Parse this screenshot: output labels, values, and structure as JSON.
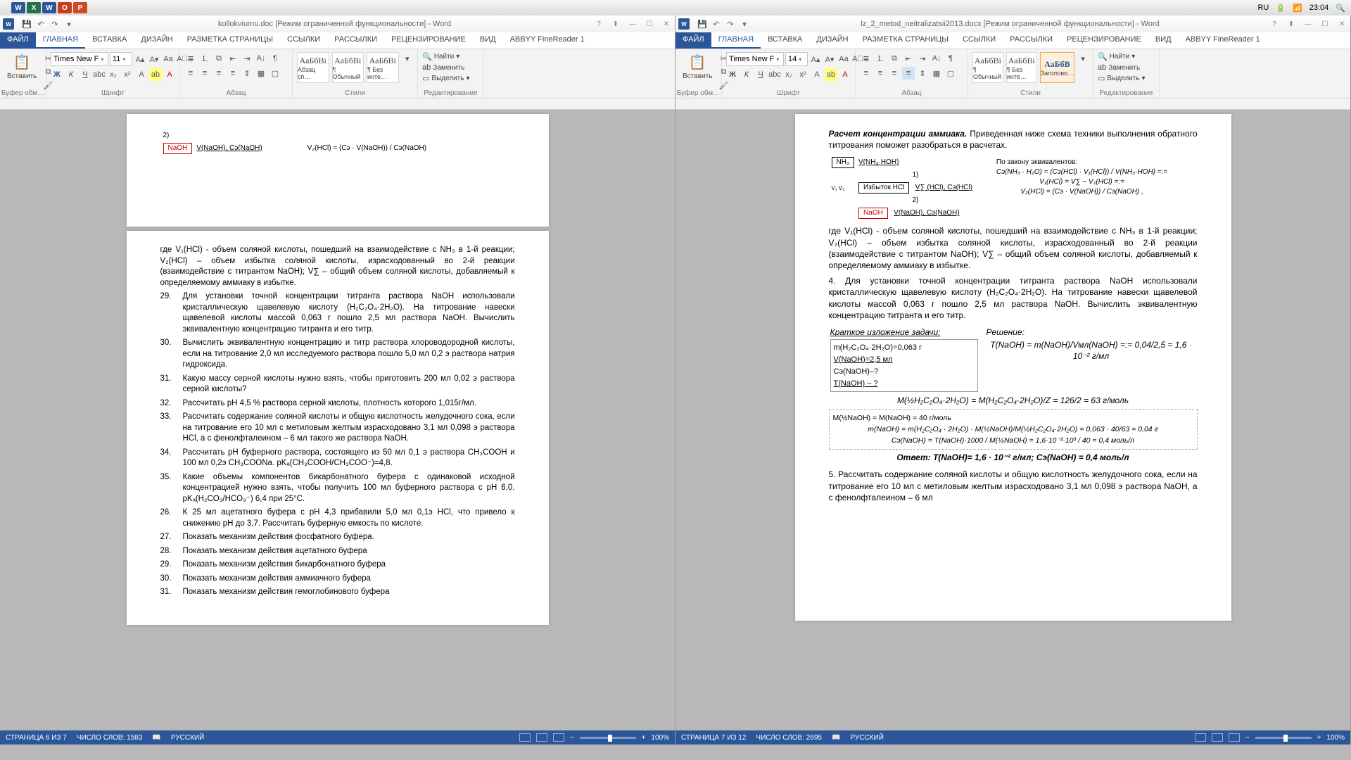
{
  "macbar": {
    "lang": "RU",
    "time": "23:04"
  },
  "left": {
    "title": "kollokviumu.doc [Режим ограниченной функциональности] - Word",
    "tabs": [
      "ФАЙЛ",
      "ГЛАВНАЯ",
      "ВСТАВКА",
      "ДИЗАЙН",
      "РАЗМЕТКА СТРАНИЦЫ",
      "ССЫЛКИ",
      "РАССЫЛКИ",
      "РЕЦЕНЗИРОВАНИЕ",
      "ВИД",
      "ABBYY FineReader 1"
    ],
    "font": "Times New F",
    "size": "11",
    "groups": {
      "clip": "Буфер обм…",
      "font": "Шрифт",
      "para": "Абзац",
      "styles": "Стили",
      "edit": "Редактирование"
    },
    "paste": "Вставить",
    "styleboxes": [
      "Абзац сп…",
      "¶ Обычный",
      "¶ Без инте…"
    ],
    "editing": {
      "find": "Найти",
      "replace": "Заменить",
      "select": "Выделить"
    },
    "status": {
      "page": "СТРАНИЦА 6 ИЗ 7",
      "words": "ЧИСЛО СЛОВ: 1583",
      "lang": "РУССКИЙ",
      "zoom": "100%"
    },
    "doc": {
      "row2": "2)",
      "cell_naoh": "NaOH",
      "v_c": "V(NaOH), Cэ(NaOH)",
      "eq1": "V₂(HCl) = (Cэ · V(NaOH)) / Cэ(NaOH)",
      "para1": "где V₁(HCl) - объем соляной кислоты, пошедший на взаимодействие с NH₃ в 1-й реакции; V₂(HCl) – объем избытка соляной кислоты,  израсходованный во 2-й реакции (взаимодействие с титрантом NaOH); V∑ – общий объем соляной кислоты, добавляемый к определяемому аммиаку в избытке.",
      "items": [
        {
          "n": "29.",
          "t": "Для установки точной концентрации титранта раствора NaOH использовали кристаллическую щавелевую кислоту (H₂C₂O₄·2H₂O). На титрование навески щавелевой кислоты массой 0,063 г пошло 2,5 мл раствора NaOH. Вычислить эквивалентную концентрацию титранта и его титр."
        },
        {
          "n": "30.",
          "t": "Вычислить эквивалентную концентрацию и титр раствора хлороводородной кислоты, если на титрование 2,0 мл исследуемого раствора пошло 5,0 мл 0,2 э раствора натрия гидроксида."
        },
        {
          "n": "31.",
          "t": "Какую массу серной кислоты нужно взять, чтобы приготовить 200 мл 0,02 э раствора серной кислоты?"
        },
        {
          "n": "32.",
          "t": "Рассчитать pH 4,5 % раствора серной кислоты, плотность которого 1,015г/мл."
        },
        {
          "n": "33.",
          "t": "Рассчитать содержание соляной кислоты и общую кислотность желудочного сока, если на титрование его 10 мл с метиловым желтым израсходовано 3,1 мл 0,098 э раствора HCl, а с фенолфталеином – 6 мл такого же раствора NaOH."
        },
        {
          "n": "34.",
          "t": "Рассчитать pH буферного раствора, состоящего из 50 мл 0,1 э раствора CH₃COOH и 100 мл 0,2э CH₃COONa. pKₐ(CH₃COOH/CH₃COO⁻)=4,8."
        },
        {
          "n": "35.",
          "t": "Какие объемы компонентов бикарбонатного буфера с одинаковой исходной концентрацией нужно взять, чтобы получить 100 мл буферного раствора с pH 6,0.  pKₐ(H₂CO₃/HCO₃⁻) 6,4 при 25°C."
        },
        {
          "n": "26.",
          "t": "К 25 мл ацетатного буфера с pH 4,3 прибавили 5,0 мл 0,1э HCl, что привело к снижению pH до 3,7. Рассчитать буферную емкость по кислоте."
        },
        {
          "n": "27.",
          "t": "Показать механизм действия фосфатного буфера."
        },
        {
          "n": "28.",
          "t": "Показать механизм действия ацетатного буфера"
        },
        {
          "n": "29.",
          "t": "Показать механизм действия бикарбонатного буфера"
        },
        {
          "n": "30.",
          "t": "Показать механизм действия аммиачного буфера"
        },
        {
          "n": "31.",
          "t": "Показать механизм действия гемоглобинового буфера"
        }
      ]
    }
  },
  "right": {
    "title": "lz_2_metod_neitralizatsii2013.docx [Режим ограниченной функциональности] - Word",
    "font": "Times New F",
    "size": "14",
    "styleboxes": [
      "¶ Обычный",
      "¶ Без инте…",
      "Заголово…"
    ],
    "status": {
      "page": "СТРАНИЦА 7 ИЗ 12",
      "words": "ЧИСЛО СЛОВ: 2695",
      "lang": "РУССКИЙ",
      "zoom": "100%"
    },
    "doc": {
      "h1": "Расчет концентрации аммиака.",
      "p0": "Приведенная ниже схема техники выполнения обратного титрования поможет разобраться в расчетах.",
      "diag": {
        "nh3": "NH₃",
        "vnh": "V(NH₃·HOH)",
        "r1": "1)",
        "izb": "Избыток HCl",
        "v12": "V₁    V₂",
        "vshcl": "V∑ (HCl), Cэ(HCl)",
        "r2": "2)",
        "naoh": "NaOH",
        "vnaoh": "V(NaOH), Cэ(NaOH)"
      },
      "law": "По закону эквивалентов:",
      "eq1": "Cэ(NH₃ · H₂O) = (Cэ(HCl) · V₁(HCl)) / V(NH₃·HOH) =:=",
      "eq2": "V₁(HCl) = V∑ − V₂(HCl) =:=",
      "eq3": "V₂(HCl) = (Cэ · V(NaOH)) / Cэ(NaOH) ,",
      "para1": "где V₁(HCl) - объем соляной кислоты, пошедший на взаимодействие с NH₃ в 1-й реакции; V₂(HCl) – объем избытка соляной кислоты, израсходованный во 2-й реакции (взаимодействие с титрантом NaOH); V∑ – общий объем соляной кислоты, добавляемый к определяемому аммиаку в избытке.",
      "item4": "4.   Для установки точной концентрации титранта раствора NaOH использовали кристаллическую щавелевую кислоту (H₂C₂O₄·2H₂O). На титрование навески щавелевой кислоты массой 0,063 г пошло 2,5 мл раствора NaOH. Вычислить эквивалентную концентрацию титранта и его титр.",
      "brief_h": "Краткое изложение задачи:",
      "sol_h": "Решение:",
      "brief": [
        "m(H₂C₂O₄·2H₂O)=0,063 г",
        "V(NaOH)=2,5 мл",
        "Cэ(NaOH)–?",
        "T(NaOH) – ?"
      ],
      "sol1": "T(NaOH) = m(NaOH)/Vмл(NaOH) =:= 0,04/2,5 = 1,6 · 10⁻² г/мл",
      "sol2": "M(½H₂C₂O₄·2H₂O) = M(H₂C₂O₄·2H₂O)/Z = 126/2 = 63 г/моль",
      "sol3": "M(½NaOH) = M(NaOH) = 40 г/моль",
      "sol4": "m(NaOH) = m(H₂C₂O₄ · 2H₂O) · M(½NaOH)/M(½H₂C₂O₄·2H₂O) = 0,063 · 40/63 = 0,04 г",
      "sol5": "Cэ(NaOH) = T(NaOH)·1000 / M(½NaOH) = 1,6·10⁻²·10³ / 40 = 0,4 моль/л",
      "ans": "Ответ: T(NaOH)= 1,6 · 10⁻² г/мл;   Cэ(NaOH) = 0,4 моль/л",
      "item5": "5.  Рассчитать содержание соляной кислоты и общую кислотность желудочного сока, если на титрование его 10 мл с метиловым желтым израсходовано 3,1 мл 0,098 э раствора NaOH, а с фенолфталеином – 6 мл"
    }
  }
}
